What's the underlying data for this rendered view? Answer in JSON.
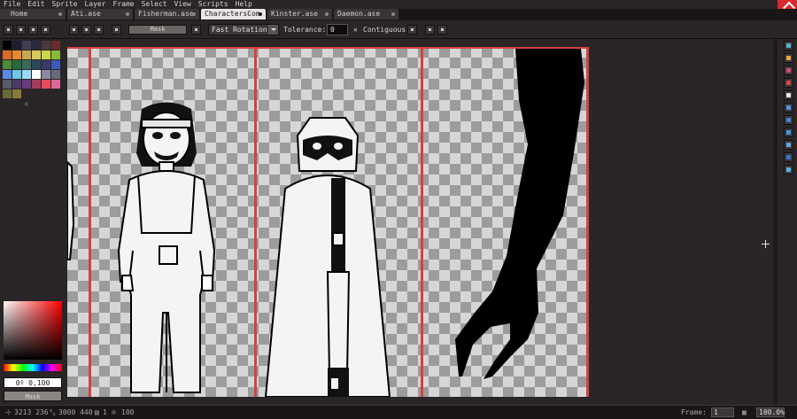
{
  "menu": [
    "File",
    "Edit",
    "Sprite",
    "Layer",
    "Frame",
    "Select",
    "View",
    "Scripts",
    "Help"
  ],
  "tabs": [
    {
      "label": "Home",
      "active": false
    },
    {
      "label": "Ati.ase",
      "active": false
    },
    {
      "label": "Fisherman.ase",
      "active": false
    },
    {
      "label": "CharactersCom",
      "active": true
    },
    {
      "label": "Kinster.ase",
      "active": false
    },
    {
      "label": "Daemon.ase",
      "active": false
    }
  ],
  "toolbar": {
    "mask_label": "Mask",
    "rotation_algorithm": "Fast Rotation",
    "tolerance_label": "Tolerance:",
    "tolerance_value": "0",
    "contiguous_label": "Contiguous"
  },
  "palette": {
    "colors": [
      "#000000",
      "#1e1e2c",
      "#3f3f56",
      "#2a2a3c",
      "#4a3a3a",
      "#6a2a2a",
      "#d86a2a",
      "#e88a2a",
      "#c8a84a",
      "#d8c85a",
      "#c8d84a",
      "#8ab83a",
      "#4a8a3a",
      "#2a6a3a",
      "#3a6a5a",
      "#2a4a5a",
      "#3a3a6a",
      "#3a5ab8",
      "#5a8ae8",
      "#6ac8e8",
      "#9ad8f8",
      "#ffffff",
      "#8a8aa8",
      "#6a6a7a",
      "#5a5a6a",
      "#4a3a6a",
      "#6a3a7a",
      "#a83a5a",
      "#e84a5a",
      "#d86a9a",
      "#6a6a3a",
      "#8a7a3a"
    ],
    "last_index": "0"
  },
  "color_value": "0º 0,100",
  "mask_swatch_label": "Mask",
  "status": {
    "coords": "3213 236",
    "size": "3000 440",
    "layer": "1",
    "frames": "100",
    "frame_label": "Frame:",
    "frame_value": "1",
    "zoom": "100.0%"
  }
}
